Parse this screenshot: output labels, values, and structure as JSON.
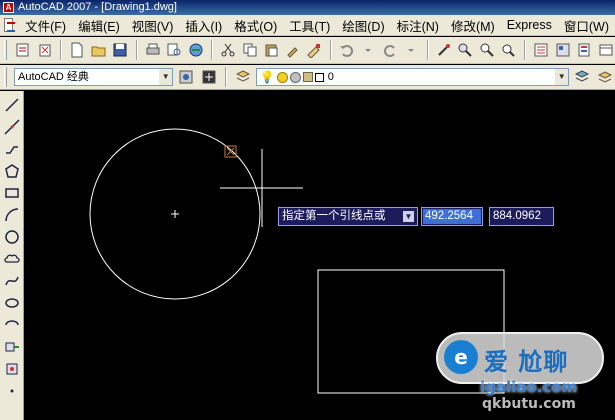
{
  "window": {
    "title": "AutoCAD 2007 - [Drawing1.dwg]"
  },
  "menubar": {
    "items": [
      {
        "label": "文件(F)"
      },
      {
        "label": "编辑(E)"
      },
      {
        "label": "视图(V)"
      },
      {
        "label": "插入(I)"
      },
      {
        "label": "格式(O)"
      },
      {
        "label": "工具(T)"
      },
      {
        "label": "绘图(D)"
      },
      {
        "label": "标注(N)"
      },
      {
        "label": "修改(M)"
      },
      {
        "label": "Express"
      },
      {
        "label": "窗口(W)"
      }
    ]
  },
  "toolbar2": {
    "workspace": "AutoCAD 经典",
    "layer_name": "0"
  },
  "command_prompt": {
    "prompt_text": "指定第一个引线点或",
    "x_value": "492.2564",
    "y_value": "884.0962"
  },
  "watermark": {
    "logo_text": "e",
    "brand": "爱 尬聊",
    "url": "igaliao.com",
    "url2": "qkbutu.com"
  },
  "colors": {
    "canvas_bg": "#000000",
    "prompt_bg": "#1c1c5c",
    "selected_value_bg": "#3d6fd6",
    "ui_chrome": "#ece9d8"
  }
}
